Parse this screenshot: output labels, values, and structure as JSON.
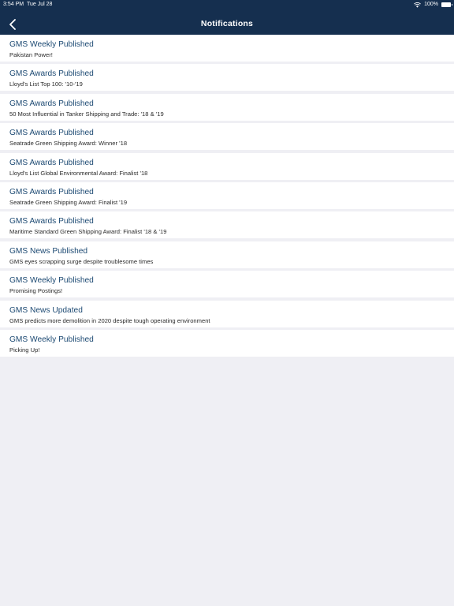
{
  "status_bar": {
    "time": "3:54 PM",
    "date": "Tue Jul 28",
    "battery": "100%"
  },
  "header": {
    "title": "Notifications",
    "back_icon": "chevron-left-icon"
  },
  "colors": {
    "header_bg": "#152f4f",
    "title_text": "#1d4a73",
    "page_bg": "#efeff4"
  },
  "notifications": [
    {
      "title": "GMS Weekly Published",
      "subtitle": "Pakistan Power!"
    },
    {
      "title": "GMS Awards Published",
      "subtitle": "Lloyd's List Top 100:  '10-'19"
    },
    {
      "title": "GMS Awards Published",
      "subtitle": "50 Most Influential in Tanker Shipping and Trade: '18 & '19"
    },
    {
      "title": "GMS Awards Published",
      "subtitle": "Seatrade Green Shipping Award: Winner '18"
    },
    {
      "title": "GMS Awards Published",
      "subtitle": "Lloyd's List Global Environmental Award: Finalist '18"
    },
    {
      "title": "GMS Awards Published",
      "subtitle": "Seatrade Green Shipping Award: Finalist '19"
    },
    {
      "title": "GMS Awards Published",
      "subtitle": "Maritime Standard Green Shipping Award: Finalist '18 & '19"
    },
    {
      "title": "GMS News Published",
      "subtitle": "GMS eyes scrapping surge despite troublesome times"
    },
    {
      "title": "GMS Weekly Published",
      "subtitle": "Promising Postings!"
    },
    {
      "title": "GMS News Updated",
      "subtitle": "GMS predicts more demolition in 2020 despite tough operating environment"
    },
    {
      "title": "GMS Weekly Published",
      "subtitle": "Picking Up!"
    }
  ]
}
